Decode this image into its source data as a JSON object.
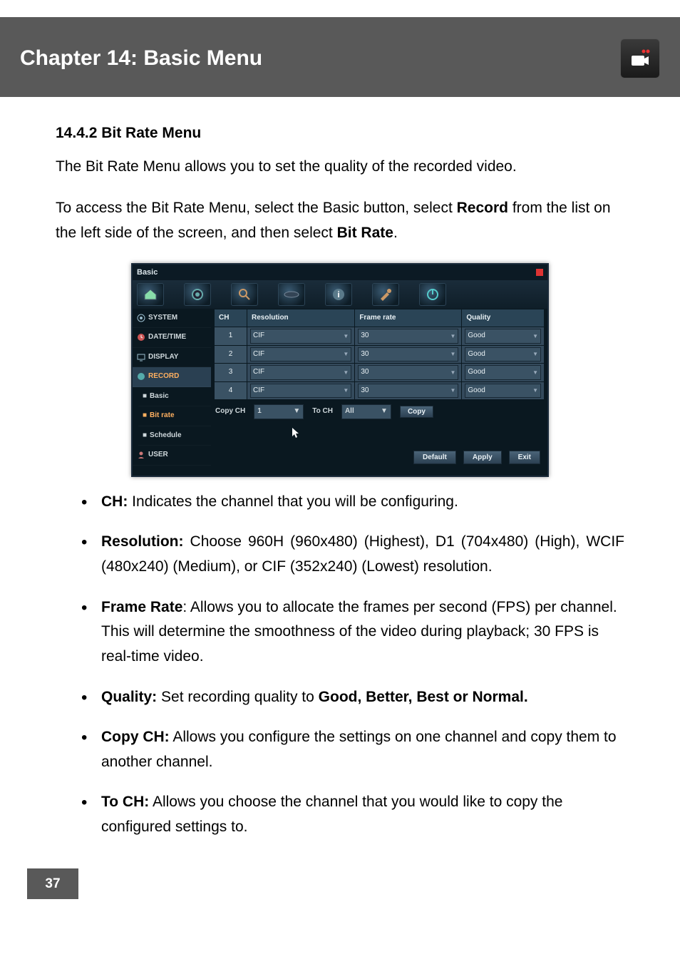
{
  "header": {
    "chapter_title": "Chapter 14: Basic Menu"
  },
  "section": {
    "number_title": "14.4.2 Bit Rate Menu",
    "intro": "The Bit Rate Menu allows you to set the quality of the recorded video.",
    "access_pre": "To access the Bit Rate Menu, select the Basic button, select ",
    "access_bold1": "Record",
    "access_mid": " from the list on the left side of the screen, and then select ",
    "access_bold2": "Bit Rate",
    "access_end": "."
  },
  "screenshot": {
    "window_title": "Basic",
    "sidebar": {
      "items": [
        {
          "label": "SYSTEM"
        },
        {
          "label": "DATE/TIME"
        },
        {
          "label": "DISPLAY"
        },
        {
          "label": "RECORD"
        }
      ],
      "sub_items": [
        {
          "label": "Basic"
        },
        {
          "label": "Bit rate"
        },
        {
          "label": "Schedule"
        }
      ],
      "user_label": "USER"
    },
    "table": {
      "headers": {
        "ch": "CH",
        "res": "Resolution",
        "fr": "Frame rate",
        "q": "Quality"
      },
      "rows": [
        {
          "ch": "1",
          "res": "CIF",
          "fr": "30",
          "q": "Good"
        },
        {
          "ch": "2",
          "res": "CIF",
          "fr": "30",
          "q": "Good"
        },
        {
          "ch": "3",
          "res": "CIF",
          "fr": "30",
          "q": "Good"
        },
        {
          "ch": "4",
          "res": "CIF",
          "fr": "30",
          "q": "Good"
        }
      ]
    },
    "copy_row": {
      "copy_ch_label": "Copy CH",
      "copy_ch_value": "1",
      "to_ch_label": "To CH",
      "to_ch_value": "All",
      "copy_button": "Copy"
    },
    "footer": {
      "default": "Default",
      "apply": "Apply",
      "exit": "Exit"
    }
  },
  "features": {
    "items": [
      {
        "term": "CH:",
        "desc": " Indicates the channel that you will be configuring."
      },
      {
        "term": "Resolution:",
        "desc": " Choose 960H (960x480) (Highest), D1 (704x480) (High), WCIF (480x240) (Medium), or CIF (352x240) (Lowest) resolution."
      },
      {
        "term": "Frame Rate",
        "desc": ": Allows you to allocate the frames per second (FPS) per channel. This will determine the smoothness of the video during playback; 30 FPS is real-time video."
      },
      {
        "term": "Quality:",
        "desc_pre": " Set recording quality to ",
        "desc_bold": "Good, Better, Best or Normal."
      },
      {
        "term": "Copy CH:",
        "desc": " Allows you configure the settings on one channel and copy them to another channel."
      },
      {
        "term": "To CH:",
        "desc": " Allows you choose the channel that you would like to copy the configured settings to."
      }
    ]
  },
  "page_number": "37"
}
